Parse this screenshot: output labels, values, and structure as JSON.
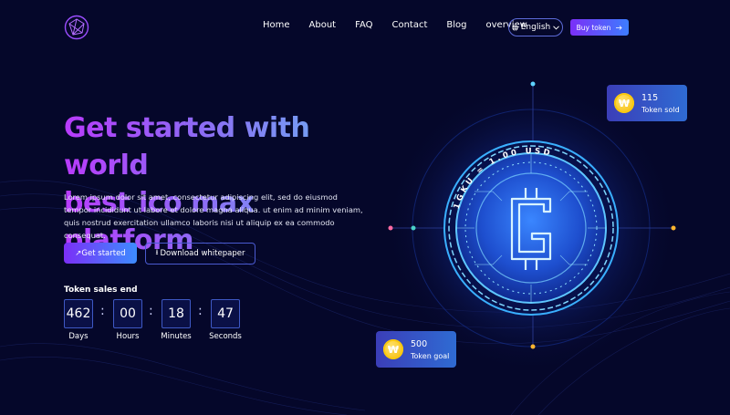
{
  "header": {
    "nav": [
      "Home",
      "About",
      "FAQ",
      "Contact",
      "Blog",
      "overview"
    ],
    "language": "English",
    "buy_label": "Buy token"
  },
  "hero": {
    "title_line1": "Get started with world",
    "title_line2": "best ico max platform",
    "description": "Lorem ipsum dolor sit amet, consectetur adipiscing elit, sed do eiusmod tempor incididunt ut labore et dolore magna aliqua. ut enim ad minim veniam, quis nostrud exercitation ullamco laboris nisi ut aliquip ex ea commodo consequat.",
    "start_label": "Get started",
    "whitepaper_label": "Download whitepaper"
  },
  "countdown": {
    "title": "Token sales end",
    "items": [
      {
        "value": "462",
        "label": "Days"
      },
      {
        "value": "00",
        "label": "Hours"
      },
      {
        "value": "18",
        "label": "Minutes"
      },
      {
        "value": "47",
        "label": "Seconds"
      }
    ]
  },
  "coin": {
    "rate_text": "1GKU = 1.00 USD",
    "symbol": "G"
  },
  "cards": {
    "sold": {
      "value": "115",
      "label": "Token sold",
      "icon": "₩"
    },
    "goal": {
      "value": "500",
      "label": "Token goal",
      "icon": "₩"
    }
  },
  "colors": {
    "background": "#05072a",
    "accent_purple": "#7b2ff7",
    "accent_blue": "#3d8cff",
    "coin_glow": "#3f9cff",
    "token_gold": "#f5b800"
  }
}
